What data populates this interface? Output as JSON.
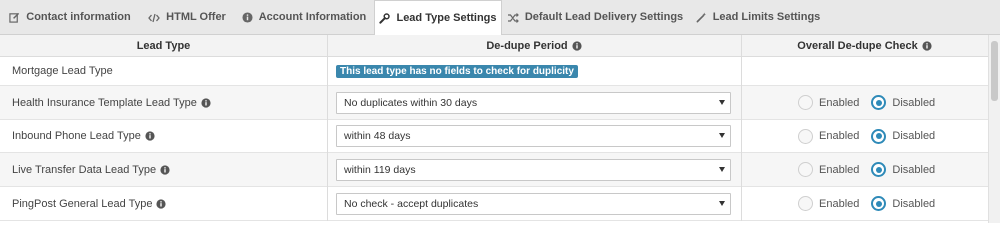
{
  "tabs": [
    {
      "label": "Contact information",
      "icon": "pencil-square-icon"
    },
    {
      "label": "HTML Offer",
      "icon": "code-icon"
    },
    {
      "label": "Account Information",
      "icon": "info-circle-icon"
    },
    {
      "label": "Lead Type Settings",
      "icon": "wrench-icon",
      "active": true
    },
    {
      "label": "Default Lead Delivery Settings",
      "icon": "random-icon"
    },
    {
      "label": "Lead Limits Settings",
      "icon": "magic-wand-icon"
    }
  ],
  "table": {
    "headers": {
      "lead_type": "Lead Type",
      "dedupe_period": "De-dupe Period",
      "overall_check": "Overall De-dupe Check"
    },
    "rows": [
      {
        "label": "Mortgage Lead Type",
        "notice": "This lead type has no fields to check for duplicity"
      },
      {
        "label": "Health Insurance Template Lead Type",
        "period": "No duplicates within 30 days",
        "enabled_label": "Enabled",
        "disabled_label": "Disabled",
        "selected": "Disabled"
      },
      {
        "label": "Inbound Phone Lead Type",
        "period": "within 48 days",
        "enabled_label": "Enabled",
        "disabled_label": "Disabled",
        "selected": "Disabled"
      },
      {
        "label": "Live Transfer Data Lead Type",
        "period": "within 119 days",
        "enabled_label": "Enabled",
        "disabled_label": "Disabled",
        "selected": "Disabled"
      },
      {
        "label": "PingPost General Lead Type",
        "period": "No check - accept duplicates",
        "enabled_label": "Enabled",
        "disabled_label": "Disabled",
        "selected": "Disabled"
      }
    ]
  },
  "colors": {
    "accent": "#2e8ab8",
    "notice_bg": "#3a87ad"
  }
}
